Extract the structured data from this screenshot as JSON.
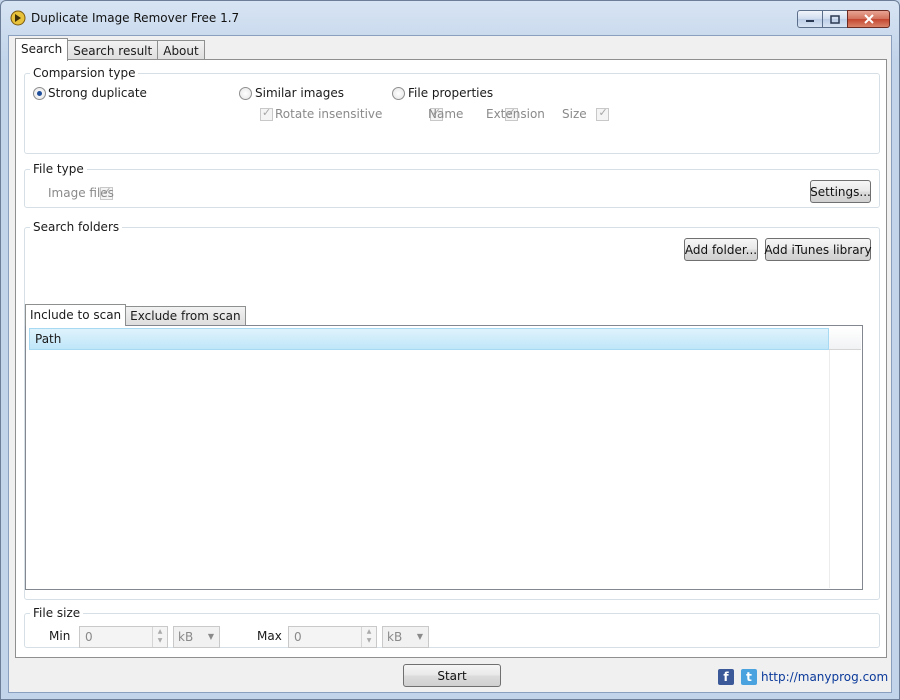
{
  "window": {
    "title": "Duplicate Image Remover Free 1.7",
    "icon": "app-icon"
  },
  "tabs": [
    {
      "label": "Search",
      "active": true
    },
    {
      "label": "Search result",
      "active": false
    },
    {
      "label": "About",
      "active": false
    }
  ],
  "comparison": {
    "legend": "Comparsion type",
    "options": [
      {
        "label": "Strong duplicate",
        "selected": true
      },
      {
        "label": "Similar images",
        "selected": false
      },
      {
        "label": "File properties",
        "selected": false
      }
    ],
    "rotate_insensitive": "Rotate insensitive",
    "property_checks": [
      "Name",
      "Extension",
      "Size"
    ]
  },
  "file_type": {
    "legend": "File type",
    "image_files": "Image files",
    "settings_button": "Settings..."
  },
  "search_folders": {
    "legend": "Search folders",
    "add_folder_button": "Add folder...",
    "add_itunes_button": "Add iTunes library",
    "tabs": [
      {
        "label": "Include to scan",
        "active": true
      },
      {
        "label": "Exclude from scan",
        "active": false
      }
    ],
    "column_header": "Path"
  },
  "file_size": {
    "legend": "File size",
    "min_label": "Min",
    "min_value": "0",
    "min_unit": "kB",
    "max_label": "Max",
    "max_value": "0",
    "max_unit": "kB"
  },
  "start_button": "Start",
  "footer": {
    "facebook": "f",
    "twitter": "t",
    "link": "http://manyprog.com"
  },
  "colors": {
    "accent_selection": "#bfe6f9",
    "link": "#0b3a9b",
    "facebook": "#3b5998",
    "twitter": "#4aa3df"
  }
}
